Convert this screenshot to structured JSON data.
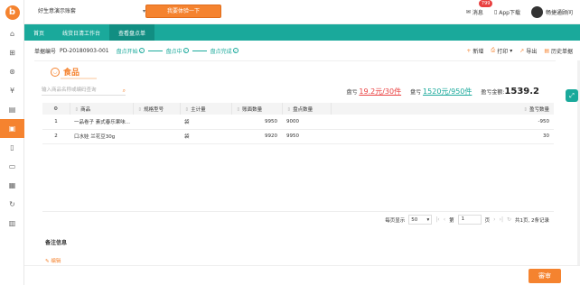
{
  "topbar": {
    "shop_name": "好生意演示账套",
    "experience_button": "我要体验一下",
    "messages_label": "消息",
    "messages_badge": "799",
    "app_download": "App下载",
    "user_name": "畅捷通顾问"
  },
  "nav": {
    "tabs": [
      {
        "label": "首页"
      },
      {
        "label": "线货日清工作台"
      },
      {
        "label": "查看盘点单"
      }
    ]
  },
  "info": {
    "doc_label": "单据编号",
    "doc_number": "PD-20180903-001",
    "steps": [
      "盘点开始",
      "盘点中",
      "盘点完成"
    ],
    "actions": [
      {
        "icon": "plus-icon",
        "label": "新增"
      },
      {
        "icon": "print-icon",
        "label": "打印"
      },
      {
        "icon": "export-icon",
        "label": "导出"
      },
      {
        "icon": "history-icon",
        "label": "历史单据"
      }
    ]
  },
  "category": {
    "title": "食品",
    "icon": "plate-icon"
  },
  "search": {
    "placeholder": "输入商品名称或编码查询"
  },
  "summary": {
    "loss_label": "盘亏",
    "loss_value": "19.2元/30件",
    "gain_label": "盘亏",
    "gain_value": "1520元/950件",
    "total_label": "盈亏金额:",
    "total_value": "1539.2"
  },
  "table": {
    "headers": [
      "商品",
      "规格型号",
      "主计量",
      "账面数量",
      "盘点数量",
      "盈亏数量"
    ],
    "rows": [
      {
        "index": "1",
        "product": "一品卷子 素式春乐果味...",
        "spec": "",
        "unit": "袋",
        "book_qty": "9950",
        "count_qty": "9000",
        "diff": "-950"
      },
      {
        "index": "2",
        "product": "口水娃 兰花豆30g",
        "spec": "",
        "unit": "袋",
        "book_qty": "9920",
        "count_qty": "9950",
        "diff": "30"
      }
    ]
  },
  "pager": {
    "per_page_label": "每页显示",
    "per_page": "50",
    "page_prefix": "第",
    "page": "1",
    "page_suffix": "页",
    "summary": "共1页, 2条记录"
  },
  "remark": {
    "label": "备注信息",
    "edit": "编辑"
  },
  "bottom": {
    "submit": "審审"
  },
  "colors": {
    "accent": "#f5832f",
    "teal": "#1aa99b",
    "loss": "#e94040"
  }
}
